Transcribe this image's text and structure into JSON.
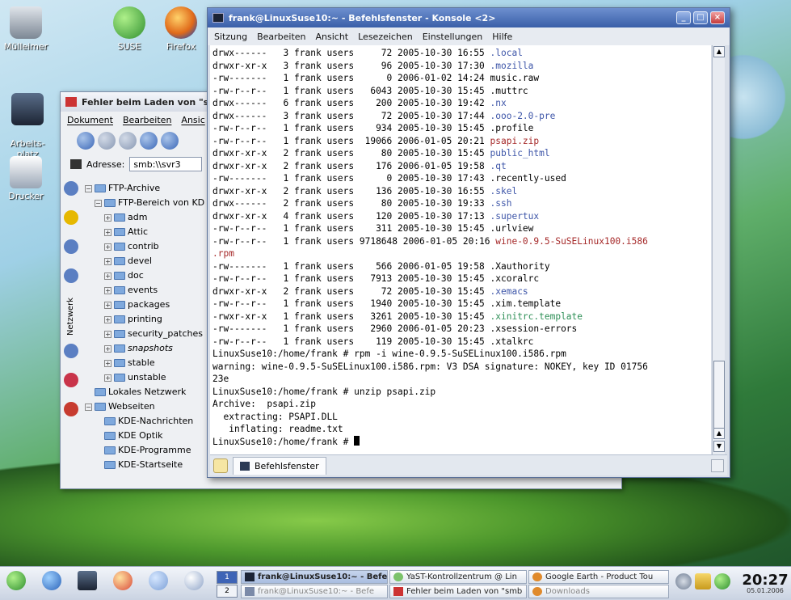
{
  "desktop": {
    "icons": [
      {
        "label": "Mülleimer"
      },
      {
        "label": "SUSE"
      },
      {
        "label": "Firefox"
      },
      {
        "label": "Arbeits-\nplatz"
      },
      {
        "label": "Drucker"
      }
    ]
  },
  "konqueror": {
    "title": "Fehler beim Laden von \"smb:",
    "menu": [
      "Dokument",
      "Bearbeiten",
      "Ansic"
    ],
    "address_label": "Adresse:",
    "address_value": "smb:\\\\svr3",
    "side_tab_label": "Netzwerk",
    "tree": [
      {
        "label": "FTP-Archive",
        "level": 0,
        "pm": "⊟"
      },
      {
        "label": "FTP-Bereich von KD",
        "level": 1,
        "pm": "⊟"
      },
      {
        "label": "adm",
        "level": 2,
        "pm": "⊞"
      },
      {
        "label": "Attic",
        "level": 2,
        "pm": "⊞"
      },
      {
        "label": "contrib",
        "level": 2,
        "pm": "⊞"
      },
      {
        "label": "devel",
        "level": 2,
        "pm": "⊞"
      },
      {
        "label": "doc",
        "level": 2,
        "pm": "⊞"
      },
      {
        "label": "events",
        "level": 2,
        "pm": "⊞"
      },
      {
        "label": "packages",
        "level": 2,
        "pm": "⊞"
      },
      {
        "label": "printing",
        "level": 2,
        "pm": "⊞"
      },
      {
        "label": "security_patches",
        "level": 2,
        "pm": "⊞"
      },
      {
        "label": "snapshots",
        "level": 2,
        "pm": "⊞"
      },
      {
        "label": "stable",
        "level": 2,
        "pm": "⊞"
      },
      {
        "label": "unstable",
        "level": 2,
        "pm": "⊞"
      },
      {
        "label": "Lokales Netzwerk",
        "level": 0,
        "pm": ""
      },
      {
        "label": "Webseiten",
        "level": 0,
        "pm": "⊟"
      },
      {
        "label": "KDE-Nachrichten",
        "level": 1,
        "pm": ""
      },
      {
        "label": "KDE Optik",
        "level": 1,
        "pm": ""
      },
      {
        "label": "KDE-Programme",
        "level": 1,
        "pm": ""
      },
      {
        "label": "KDE-Startseite",
        "level": 1,
        "pm": ""
      }
    ]
  },
  "konsole": {
    "title": "frank@LinuxSuse10:~ - Befehlsfenster - Konsole <2>",
    "menu": [
      "Sitzung",
      "Bearbeiten",
      "Ansicht",
      "Lesezeichen",
      "Einstellungen",
      "Hilfe"
    ],
    "tab_label": "Befehlsfenster",
    "lines": [
      {
        "t": "drwx------   3 frank users     72 2005-10-30 16:55 ",
        "n": ".local",
        "c": "blue"
      },
      {
        "t": "drwxr-xr-x   3 frank users     96 2005-10-30 17:30 ",
        "n": ".mozilla",
        "c": "blue"
      },
      {
        "t": "-rw-------   1 frank users      0 2006-01-02 14:24 ",
        "n": "music.raw",
        "c": ""
      },
      {
        "t": "-rw-r--r--   1 frank users   6043 2005-10-30 15:45 ",
        "n": ".muttrc",
        "c": ""
      },
      {
        "t": "drwx------   6 frank users    200 2005-10-30 19:42 ",
        "n": ".nx",
        "c": "blue"
      },
      {
        "t": "drwx------   3 frank users     72 2005-10-30 17:44 ",
        "n": ".ooo-2.0-pre",
        "c": "blue"
      },
      {
        "t": "-rw-r--r--   1 frank users    934 2005-10-30 15:45 ",
        "n": ".profile",
        "c": ""
      },
      {
        "t": "-rw-r--r--   1 frank users  19066 2006-01-05 20:21 ",
        "n": "psapi.zip",
        "c": "red"
      },
      {
        "t": "drwxr-xr-x   2 frank users     80 2005-10-30 15:45 ",
        "n": "public_html",
        "c": "blue"
      },
      {
        "t": "drwxr-xr-x   2 frank users    176 2006-01-05 19:58 ",
        "n": ".qt",
        "c": "blue"
      },
      {
        "t": "-rw-------   1 frank users      0 2005-10-30 17:43 ",
        "n": ".recently-used",
        "c": ""
      },
      {
        "t": "drwxr-xr-x   2 frank users    136 2005-10-30 16:55 ",
        "n": ".skel",
        "c": "blue"
      },
      {
        "t": "drwx------   2 frank users     80 2005-10-30 19:33 ",
        "n": ".ssh",
        "c": "blue"
      },
      {
        "t": "drwxr-xr-x   4 frank users    120 2005-10-30 17:13 ",
        "n": ".supertux",
        "c": "blue"
      },
      {
        "t": "-rw-r--r--   1 frank users    311 2005-10-30 15:45 ",
        "n": ".urlview",
        "c": ""
      },
      {
        "t": "-rw-r--r--   1 frank users 9718648 2006-01-05 20:16 ",
        "n": "wine-0.9.5-SuSELinux100.i586",
        "c": "red"
      },
      {
        "t": "",
        "n": ".rpm",
        "c": "red"
      },
      {
        "t": "-rw-------   1 frank users    566 2006-01-05 19:58 ",
        "n": ".Xauthority",
        "c": ""
      },
      {
        "t": "-rw-r--r--   1 frank users   7913 2005-10-30 15:45 ",
        "n": ".xcoralrc",
        "c": ""
      },
      {
        "t": "drwxr-xr-x   2 frank users     72 2005-10-30 15:45 ",
        "n": ".xemacs",
        "c": "blue"
      },
      {
        "t": "-rw-r--r--   1 frank users   1940 2005-10-30 15:45 ",
        "n": ".xim.template",
        "c": ""
      },
      {
        "t": "-rwxr-xr-x   1 frank users   3261 2005-10-30 15:45 ",
        "n": ".xinitrc.template",
        "c": "green"
      },
      {
        "t": "-rw-------   1 frank users   2960 2006-01-05 20:23 ",
        "n": ".xsession-errors",
        "c": ""
      },
      {
        "t": "-rw-r--r--   1 frank users    119 2005-10-30 15:45 ",
        "n": ".xtalkrc",
        "c": ""
      },
      {
        "t": "LinuxSuse10:/home/frank # rpm -i wine-0.9.5-SuSELinux100.i586.rpm",
        "n": "",
        "c": ""
      },
      {
        "t": "warning: wine-0.9.5-SuSELinux100.i586.rpm: V3 DSA signature: NOKEY, key ID 01756",
        "n": "",
        "c": ""
      },
      {
        "t": "23e",
        "n": "",
        "c": ""
      },
      {
        "t": "LinuxSuse10:/home/frank # unzip psapi.zip",
        "n": "",
        "c": ""
      },
      {
        "t": "Archive:  psapi.zip",
        "n": "",
        "c": ""
      },
      {
        "t": "  extracting: PSAPI.DLL",
        "n": "",
        "c": ""
      },
      {
        "t": "   inflating: readme.txt",
        "n": "",
        "c": ""
      }
    ],
    "prompt": "LinuxSuse10:/home/frank # "
  },
  "taskbar": {
    "pager": [
      "1",
      "2"
    ],
    "tasks": [
      {
        "label": "frank@LinuxSuse10:~ - Befe",
        "active": true
      },
      {
        "label": "YaST-Kontrollzentrum @ Lin",
        "active": false
      },
      {
        "label": "Google Earth - Product Tou",
        "active": false
      },
      {
        "label": "frank@LinuxSuse10:~ - Befe",
        "active": false
      },
      {
        "label": "Fehler beim Laden von \"smb",
        "active": false
      },
      {
        "label": "Downloads",
        "active": false
      }
    ],
    "time": "20:27",
    "date": "05.01.2006"
  },
  "colors": {
    "term_blue": "#3d55a8",
    "term_red": "#a52828",
    "term_green": "#2e8f57",
    "konsole_title": "#3a5fa8"
  }
}
